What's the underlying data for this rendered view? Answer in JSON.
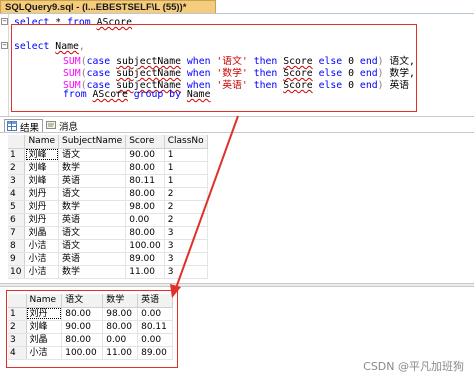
{
  "tab": {
    "title": "SQLQuery9.sql - (l...EBESTSELF\\L (55))*"
  },
  "editor": {
    "line1": {
      "kw1": "select",
      "rest": " * ",
      "kw2": "from",
      "tbl": "AScore"
    },
    "select_kw": "select",
    "name_col": "Name",
    "sum_fn": "SUM",
    "case_kw": "case",
    "subject_col": "subjectName",
    "when_kw": "when",
    "then_kw": "then",
    "score_col": "Score",
    "else_kw": "else",
    "zero": "0",
    "end_kw": "end",
    "subjects": [
      "'语文'",
      "'数学'",
      "'英语'"
    ],
    "aliases": [
      "语文,",
      "数学,",
      "英语"
    ],
    "from_kw": "from",
    "table": "AScore",
    "group_kw": "group by",
    "group_col": "Name"
  },
  "result_tabs": {
    "results": "结果",
    "messages": "消息"
  },
  "grid1": {
    "columns": [
      "Name",
      "SubjectName",
      "Score",
      "ClassNo"
    ],
    "rows": [
      [
        "1",
        "刘峰",
        "语文",
        "90.00",
        "1"
      ],
      [
        "2",
        "刘峰",
        "数学",
        "80.00",
        "1"
      ],
      [
        "3",
        "刘峰",
        "英语",
        "80.11",
        "1"
      ],
      [
        "4",
        "刘丹",
        "语文",
        "80.00",
        "2"
      ],
      [
        "5",
        "刘丹",
        "数学",
        "98.00",
        "2"
      ],
      [
        "6",
        "刘丹",
        "英语",
        "0.00",
        "2"
      ],
      [
        "7",
        "刘晶",
        "语文",
        "80.00",
        "3"
      ],
      [
        "8",
        "小洁",
        "语文",
        "100.00",
        "3"
      ],
      [
        "9",
        "小洁",
        "英语",
        "89.00",
        "3"
      ],
      [
        "10",
        "小洁",
        "数学",
        "11.00",
        "3"
      ]
    ]
  },
  "grid2": {
    "columns": [
      "Name",
      "语文",
      "数学",
      "英语"
    ],
    "rows": [
      [
        "1",
        "刘丹",
        "80.00",
        "98.00",
        "0.00"
      ],
      [
        "2",
        "刘峰",
        "90.00",
        "80.00",
        "80.11"
      ],
      [
        "3",
        "刘晶",
        "80.00",
        "0.00",
        "0.00"
      ],
      [
        "4",
        "小洁",
        "100.00",
        "11.00",
        "89.00"
      ]
    ]
  },
  "watermark": "CSDN @平凡加班狗",
  "colors": {
    "annotation": "#e0302a",
    "keyword": "#0000ff",
    "function": "#ff00ff",
    "string": "#cc0000",
    "tab": "#f5cc7c"
  }
}
